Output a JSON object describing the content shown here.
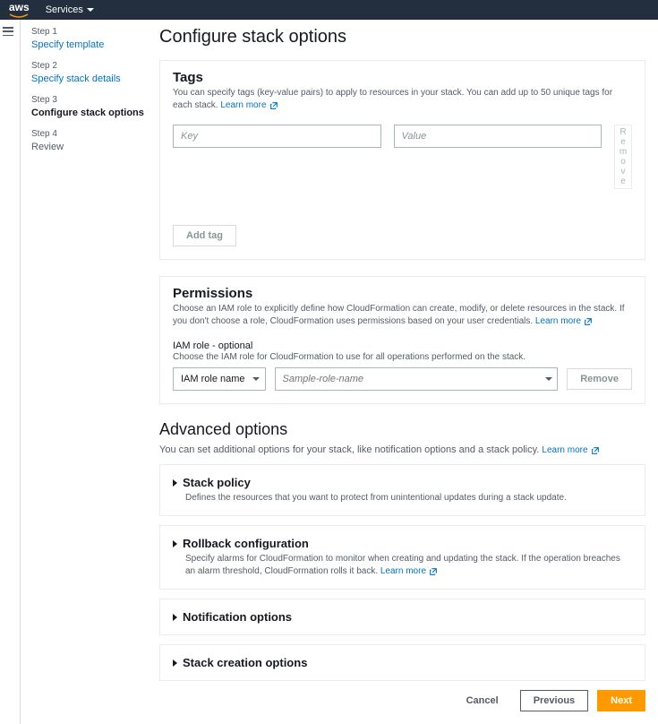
{
  "topnav": {
    "logo": "aws",
    "services": "Services"
  },
  "steps": [
    {
      "label": "Step 1",
      "title": "Specify template",
      "state": "link"
    },
    {
      "label": "Step 2",
      "title": "Specify stack details",
      "state": "link"
    },
    {
      "label": "Step 3",
      "title": "Configure stack options",
      "state": "active"
    },
    {
      "label": "Step 4",
      "title": "Review",
      "state": ""
    }
  ],
  "page_title": "Configure stack options",
  "tags": {
    "heading": "Tags",
    "desc": "You can specify tags (key-value pairs) to apply to resources in your stack. You can add up to 50 unique tags for each stack.",
    "learn": "Learn more",
    "key_placeholder": "Key",
    "value_placeholder": "Value",
    "remove_chars": [
      "R",
      "e",
      "m",
      "o",
      "v",
      "e"
    ],
    "add_tag": "Add tag"
  },
  "permissions": {
    "heading": "Permissions",
    "desc": "Choose an IAM role to explicitly define how CloudFormation can create, modify, or delete resources in the stack. If you don't choose a role, CloudFormation uses permissions based on your user credentials.",
    "learn": "Learn more",
    "subhead": "IAM role - optional",
    "subdesc": "Choose the IAM role for CloudFormation to use for all operations performed on the stack.",
    "select_label": "IAM role name",
    "role_placeholder": "Sample-role-name",
    "remove": "Remove"
  },
  "advanced": {
    "heading": "Advanced options",
    "desc": "You can set additional options for your stack, like notification options and a stack policy.",
    "learn": "Learn more",
    "items": [
      {
        "title": "Stack policy",
        "desc": "Defines the resources that you want to protect from unintentional updates during a stack update."
      },
      {
        "title": "Rollback configuration",
        "desc": "Specify alarms for CloudFormation to monitor when creating and updating the stack. If the operation breaches an alarm threshold, CloudFormation rolls it back.",
        "learn": "Learn more"
      },
      {
        "title": "Notification options",
        "desc": ""
      },
      {
        "title": "Stack creation options",
        "desc": ""
      }
    ]
  },
  "footer": {
    "cancel": "Cancel",
    "previous": "Previous",
    "next": "Next"
  }
}
